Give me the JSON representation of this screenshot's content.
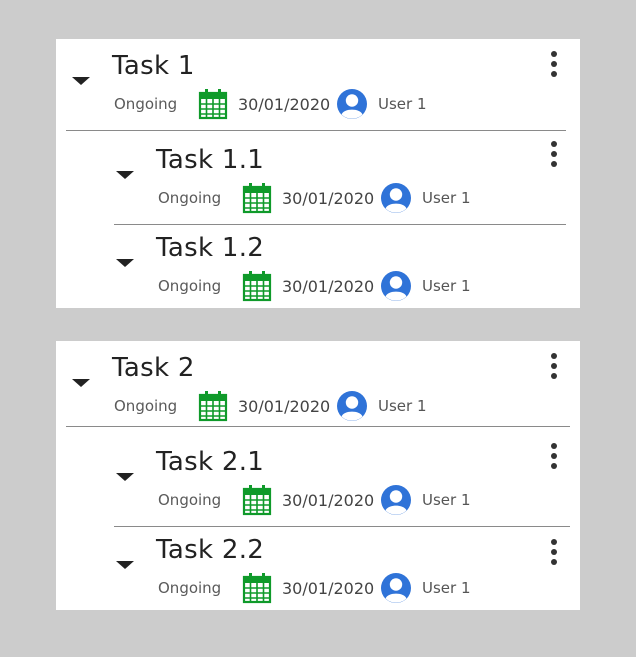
{
  "groups": [
    {
      "parent": {
        "title": "Task 1",
        "status": "Ongoing",
        "date": "30/01/2020",
        "user": "User 1"
      },
      "children": [
        {
          "title": "Task 1.1",
          "status": "Ongoing",
          "date": "30/01/2020",
          "user": "User 1"
        },
        {
          "title": "Task 1.2",
          "status": "Ongoing",
          "date": "30/01/2020",
          "user": "User 1"
        }
      ]
    },
    {
      "parent": {
        "title": "Task 2",
        "status": "Ongoing",
        "date": "30/01/2020",
        "user": "User 1"
      },
      "children": [
        {
          "title": "Task 2.1",
          "status": "Ongoing",
          "date": "30/01/2020",
          "user": "User 1"
        },
        {
          "title": "Task 2.2",
          "status": "Ongoing",
          "date": "30/01/2020",
          "user": "User 1"
        }
      ]
    }
  ],
  "icons": {
    "expand": "caret-down-icon",
    "date": "calendar-icon",
    "assignee": "user-avatar-icon",
    "menu": "more-vertical-icon"
  },
  "colors": {
    "calendar": "#0f9a2a",
    "avatar": "#2f73d8",
    "background": "#cccccc",
    "card": "#ffffff"
  }
}
